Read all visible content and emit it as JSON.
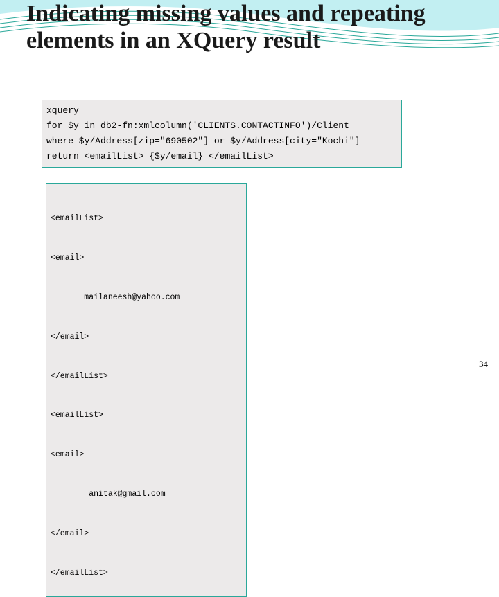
{
  "title": "Indicating missing values and repeating elements in an XQuery result",
  "query": {
    "l1": "xquery",
    "l2": "for $y in db2-fn:xmlcolumn('CLIENTS.CONTACTINFO')/Client",
    "l3": "where $y/Address[zip=\"690502\"] or $y/Address[city=\"Kochi\"]",
    "l4": "return <emailList> {$y/email} </emailList>"
  },
  "output": {
    "l1": "<emailList>",
    "l2": "<email>",
    "l3": "       mailaneesh@yahoo.com",
    "l4": "</email>",
    "l5": "</emailList>",
    "l6": "<emailList>",
    "l7": "<email>",
    "l8": "        anitak@gmail.com",
    "l9": "</email>",
    "l10": "</emailList>"
  },
  "page_number": "34"
}
